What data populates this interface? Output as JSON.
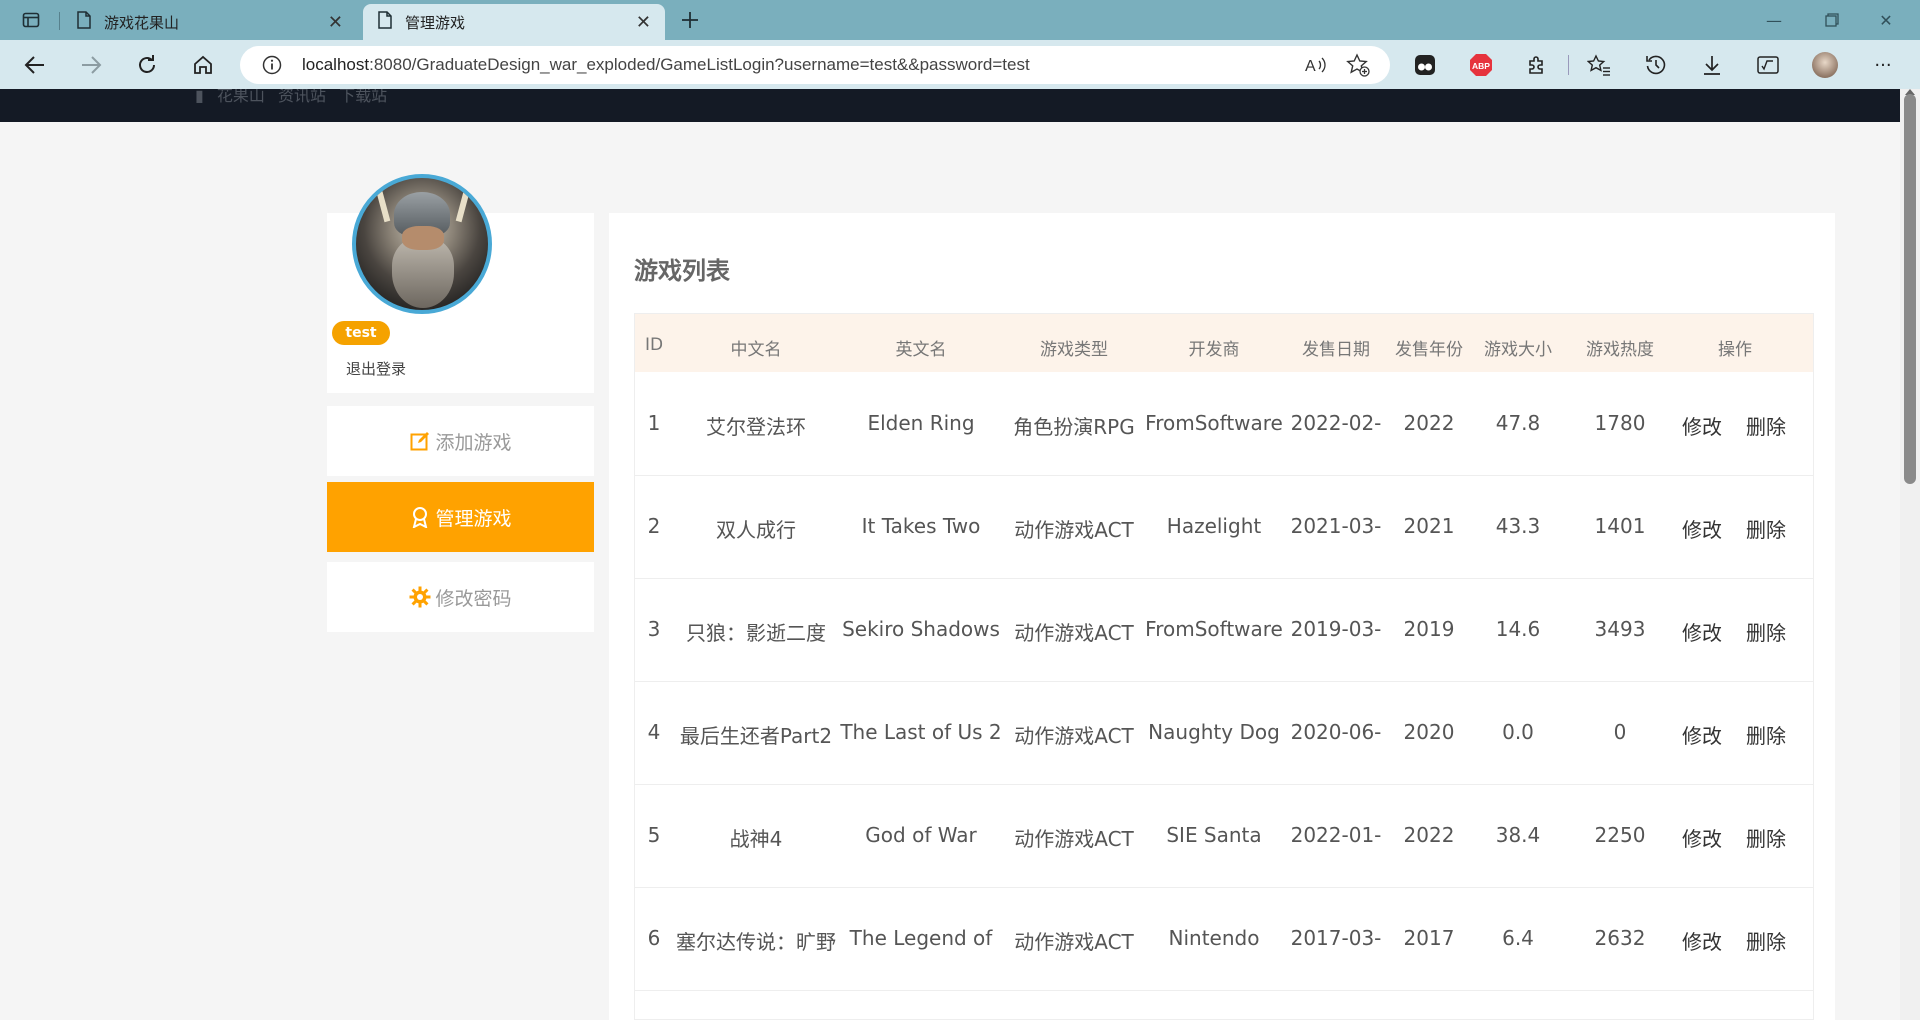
{
  "browser": {
    "tabs": [
      {
        "title": "游戏花果山",
        "active": false
      },
      {
        "title": "管理游戏",
        "active": true
      }
    ],
    "url_host": "localhost",
    "url_rest": ":8080/GraduateDesign_war_exploded/GameListLogin?username=test&&password=test",
    "extensions": [
      "tab-actions-icon",
      "read-aloud-icon",
      "favorite-add-icon",
      "tampermonkey-icon",
      "adblock-plus-icon",
      "extensions-icon",
      "favorites-icon",
      "history-icon",
      "downloads-icon",
      "math-solver-icon",
      "profile-avatar",
      "more-icon"
    ],
    "adblock_label": "ABP"
  },
  "topnav": {
    "links": [
      "花果山",
      "资讯站",
      "下载站"
    ]
  },
  "sidebar": {
    "username": "test",
    "logout_label": "退出登录",
    "menu": [
      {
        "label": "添加游戏",
        "icon": "edit-icon",
        "active": false
      },
      {
        "label": "管理游戏",
        "icon": "award-icon",
        "active": true
      },
      {
        "label": "修改密码",
        "icon": "gear-icon",
        "active": false
      }
    ]
  },
  "main": {
    "title": "游戏列表",
    "columns": [
      "ID",
      "中文名",
      "英文名",
      "游戏类型",
      "开发商",
      "发售日期",
      "发售年份",
      "游戏大小",
      "游戏热度",
      "操作"
    ],
    "edit_label": "修改",
    "delete_label": "删除",
    "rows": [
      {
        "id": "1",
        "cn": "艾尔登法环",
        "en": "Elden Ring",
        "type": "角色扮演RPG",
        "dev": "FromSoftware",
        "date": "2022-02-",
        "year": "2022",
        "size": "47.8",
        "heat": "1780"
      },
      {
        "id": "2",
        "cn": "双人成行",
        "en": "It Takes Two",
        "type": "动作游戏ACT",
        "dev": "Hazelight",
        "date": "2021-03-",
        "year": "2021",
        "size": "43.3",
        "heat": "1401"
      },
      {
        "id": "3",
        "cn": "只狼：影逝二度",
        "en": "Sekiro Shadows",
        "type": "动作游戏ACT",
        "dev": "FromSoftware",
        "date": "2019-03-",
        "year": "2019",
        "size": "14.6",
        "heat": "3493"
      },
      {
        "id": "4",
        "cn": "最后生还者Part2",
        "en": "The Last of Us 2",
        "type": "动作游戏ACT",
        "dev": "Naughty Dog",
        "date": "2020-06-",
        "year": "2020",
        "size": "0.0",
        "heat": "0"
      },
      {
        "id": "5",
        "cn": "战神4",
        "en": "God of War",
        "type": "动作游戏ACT",
        "dev": "SIE Santa",
        "date": "2022-01-",
        "year": "2022",
        "size": "38.4",
        "heat": "2250"
      },
      {
        "id": "6",
        "cn": "塞尔达传说：旷野",
        "en": "The Legend of",
        "type": "动作游戏ACT",
        "dev": "Nintendo",
        "date": "2017-03-",
        "year": "2017",
        "size": "6.4",
        "heat": "2632"
      }
    ]
  },
  "colors": {
    "accent": "#ffa200",
    "tabbar": "#7aafbd",
    "toolbar": "#d6e8ee",
    "topnav": "#141a25",
    "table_header": "#fdf3ea"
  }
}
